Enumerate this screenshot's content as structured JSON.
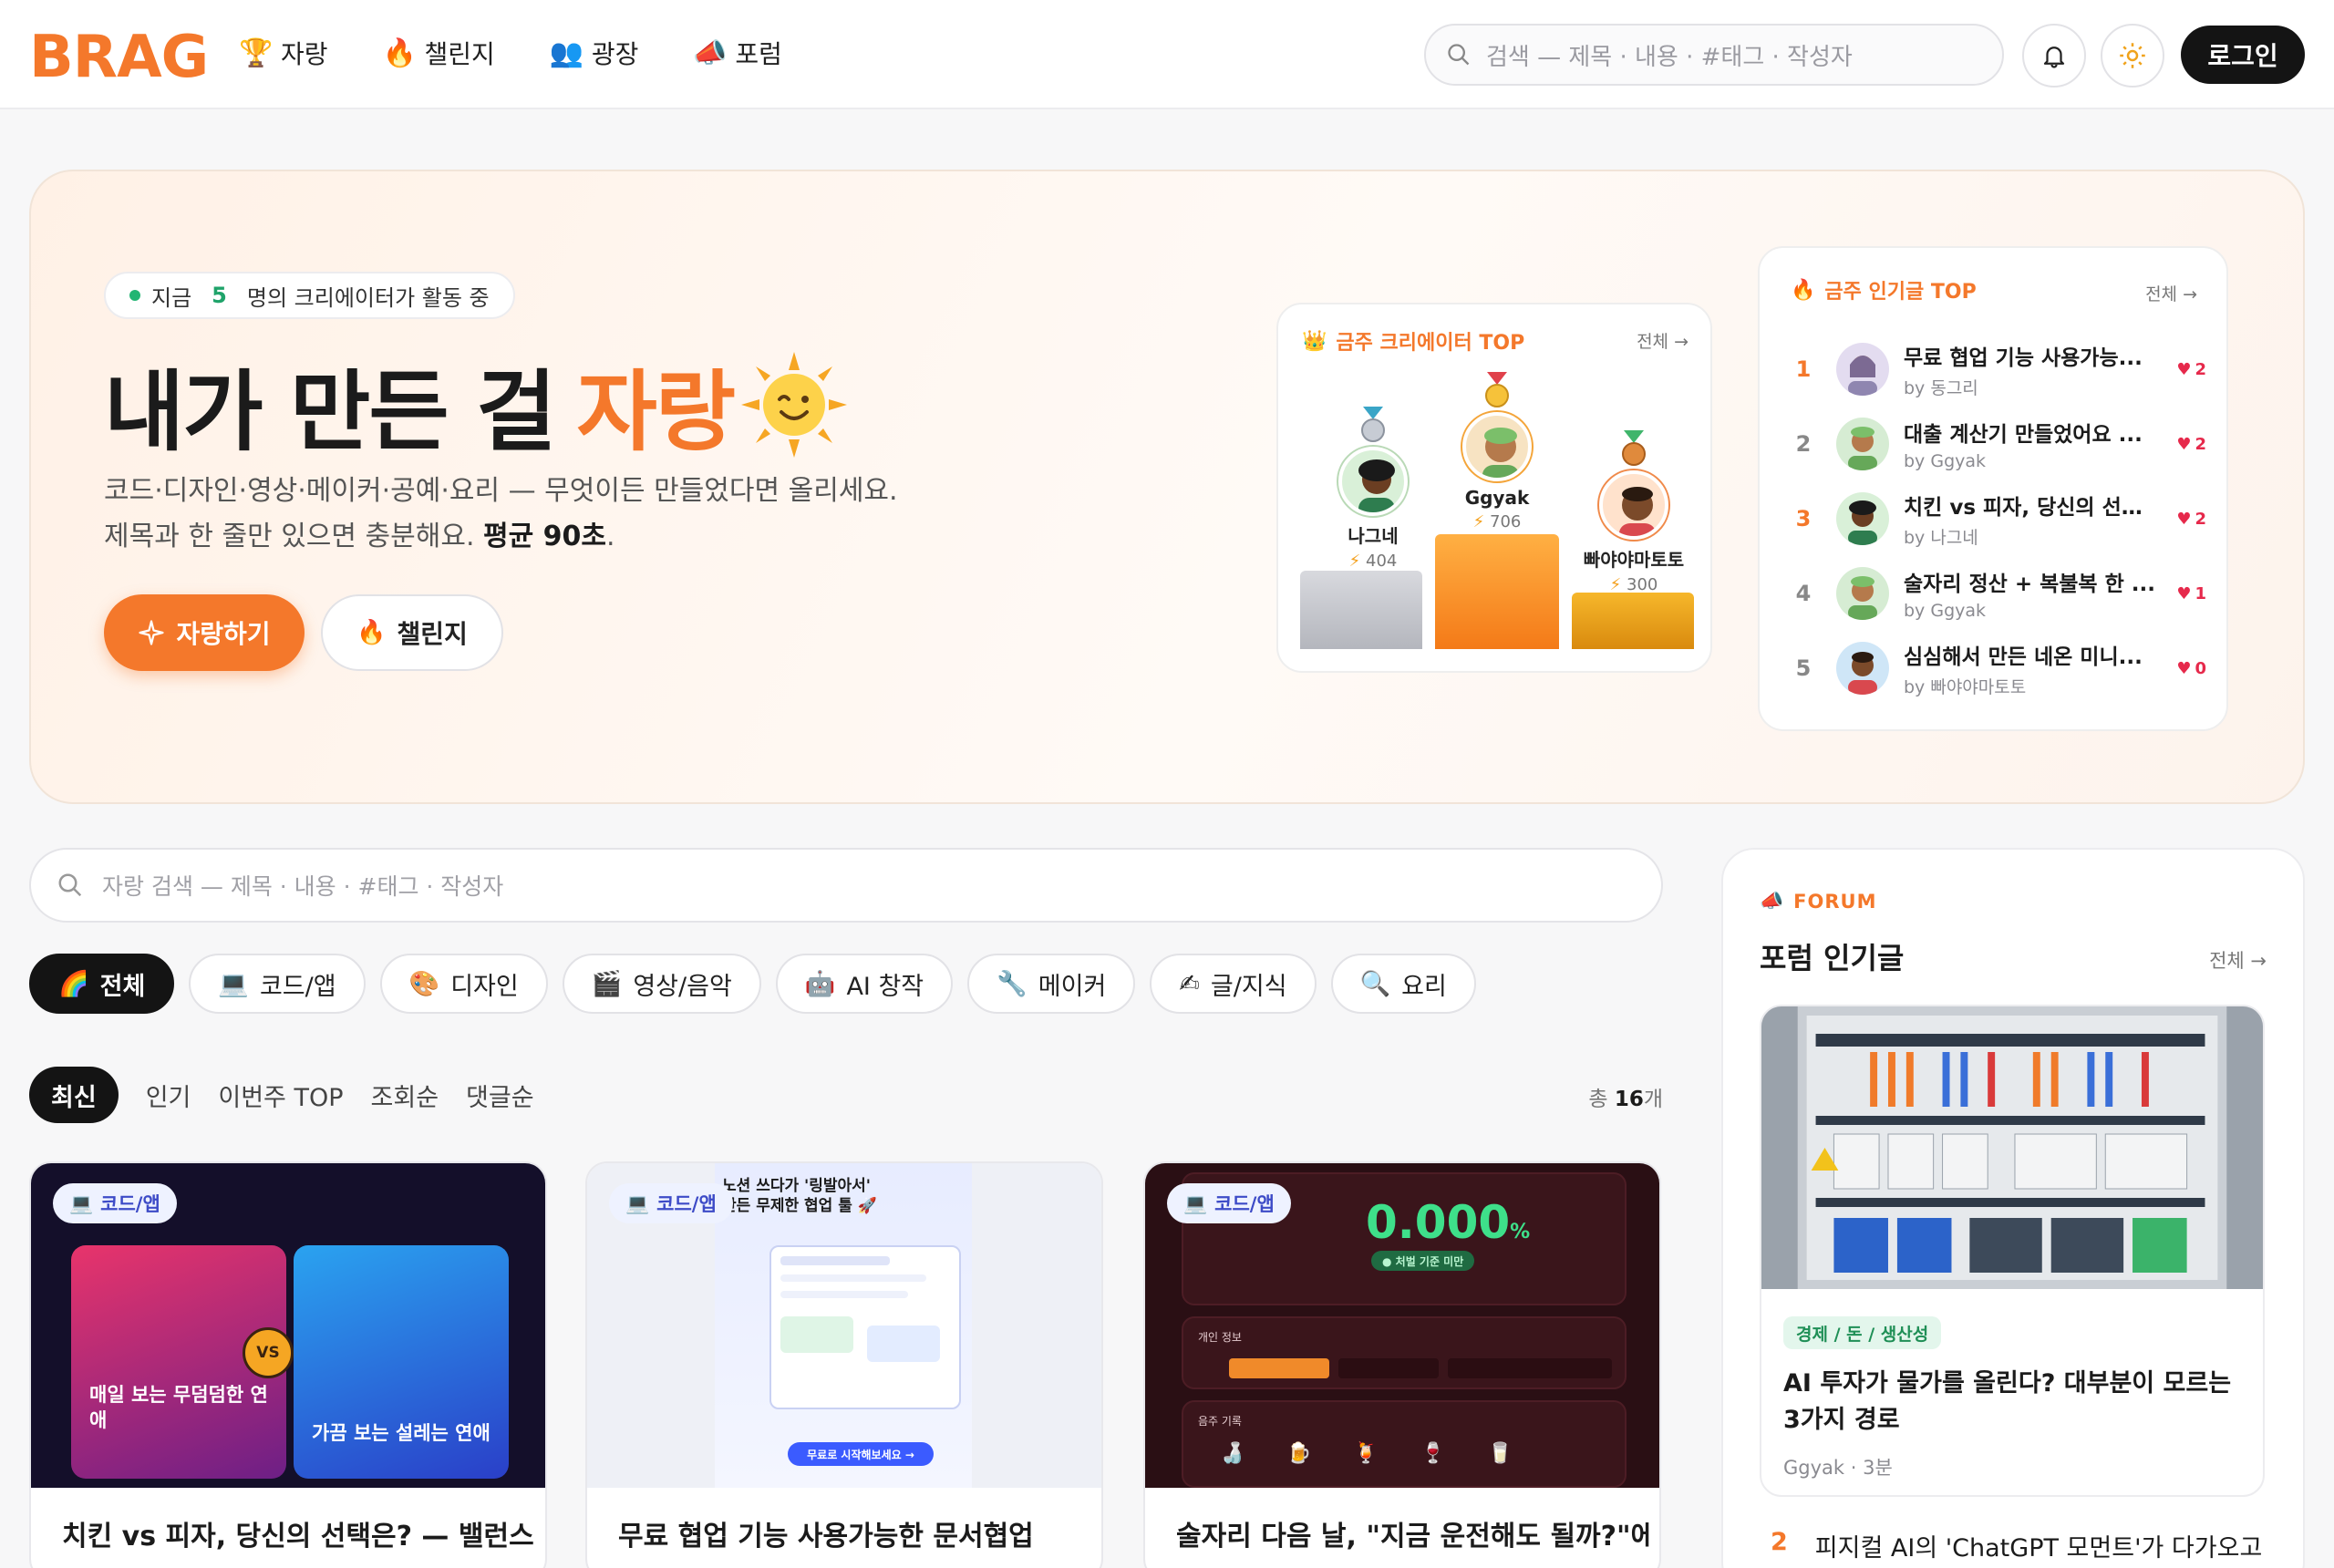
{
  "header": {
    "logo": "BRAG",
    "nav": [
      {
        "label": "자랑",
        "icon": "trophy-icon",
        "glyph": "🏆"
      },
      {
        "label": "챌린지",
        "icon": "fire-icon",
        "glyph": "🔥"
      },
      {
        "label": "광장",
        "icon": "people-icon",
        "glyph": "👥"
      },
      {
        "label": "포럼",
        "icon": "megaphone-icon",
        "glyph": "📣"
      }
    ],
    "search_placeholder": "검색 — 제목 · 내용 · #태그 · 작성자",
    "login_label": "로그인"
  },
  "hero": {
    "live_prefix": "지금",
    "live_count": "5",
    "live_suffix": "명의 크리에이터가 활동 중",
    "title_main": "내가 만든 걸",
    "title_accent": "자랑",
    "desc_line1": "코드·디자인·영상·메이커·공예·요리 — 무엇이든 만들었다면 올리세요.",
    "desc_line2_plain": "제목과 한 줄만 있으면 충분해요.",
    "desc_line2_bold": "평균 90초",
    "desc_line2_end": ".",
    "cta_primary": "자랑하기",
    "cta_secondary": "챌린지"
  },
  "podium": {
    "title": "금주 크리에이터 TOP",
    "all_label": "전체 →",
    "first": {
      "name": "Ggyak",
      "score": "706"
    },
    "second": {
      "name": "나그네",
      "score": "404"
    },
    "third": {
      "name": "빠야야마토토",
      "score": "300"
    }
  },
  "popular": {
    "title": "금주 인기글 TOP",
    "all_label": "전체 →",
    "items": [
      {
        "rank": "1",
        "title": "무료 협업 기능 사용가능...",
        "author": "by 동그리",
        "likes": "2"
      },
      {
        "rank": "2",
        "title": "대출 계산기 만들었어요 ...",
        "author": "by Ggyak",
        "likes": "2"
      },
      {
        "rank": "3",
        "title": "치킨 vs 피자, 당신의 선택...",
        "author": "by 나그네",
        "likes": "2"
      },
      {
        "rank": "4",
        "title": "술자리 정산 + 복불복 한 ...",
        "author": "by Ggyak",
        "likes": "1"
      },
      {
        "rank": "5",
        "title": "심심해서 만든 네온 미니...",
        "author": "by 빠야야마토토",
        "likes": "0"
      }
    ]
  },
  "search": {
    "placeholder": "자랑 검색 — 제목 · 내용 · #태그 · 작성자"
  },
  "categories": [
    {
      "label": "전체",
      "glyph": "🌈"
    },
    {
      "label": "코드/앱",
      "glyph": "💻"
    },
    {
      "label": "디자인",
      "glyph": "🎨"
    },
    {
      "label": "영상/음악",
      "glyph": "🎬"
    },
    {
      "label": "AI 창작",
      "glyph": "🤖"
    },
    {
      "label": "메이커",
      "glyph": "🔧"
    },
    {
      "label": "글/지식",
      "glyph": "✍"
    },
    {
      "label": "요리",
      "glyph": "🔍"
    }
  ],
  "sorts": [
    "최신",
    "인기",
    "이번주 TOP",
    "조회순",
    "댓글순"
  ],
  "total": {
    "prefix": "총",
    "count": "16",
    "suffix": "개"
  },
  "posts": [
    {
      "tag": "코드/앱",
      "title": "치킨 vs 피자, 당신의 선택은? — 밸런스",
      "left_card": "매일 보는 무덤덤한 연애",
      "right_card": "가끔 보는 설레는 연애",
      "vs": "VS"
    },
    {
      "tag": "코드/앱",
      "title": "무료 협업 기능 사용가능한 문서협업",
      "headline1": "노션 쓰다가 '링발아서'",
      "headline2": "만든 무제한 협업 툴 🚀",
      "cta": "무료로 시작해보세요 →"
    },
    {
      "tag": "코드/앱",
      "title": "술자리 다음 날, \"지금 운전해도 될까?\"에",
      "value": "0.000",
      "unit": "%",
      "badge": "● 처벌 기준 미만",
      "section1": "개인 정보",
      "section2": "음주 기록"
    }
  ],
  "forum": {
    "kicker": "FORUM",
    "title": "포럼 인기글",
    "all_label": "전체 →",
    "top": {
      "tag": "경제 / 돈 / 생산성",
      "title": "AI 투자가 물가를 올린다? 대부분이 모르는 3가지 경로",
      "meta": "Ggyak · 3분"
    },
    "second": {
      "rank": "2",
      "title": "피지컬 AI의 'ChatGPT 모먼트'가 다가오고"
    }
  },
  "colors": {
    "accent": "#f4782b",
    "dark": "#141414",
    "like": "#e6294b",
    "live": "#22b573"
  }
}
